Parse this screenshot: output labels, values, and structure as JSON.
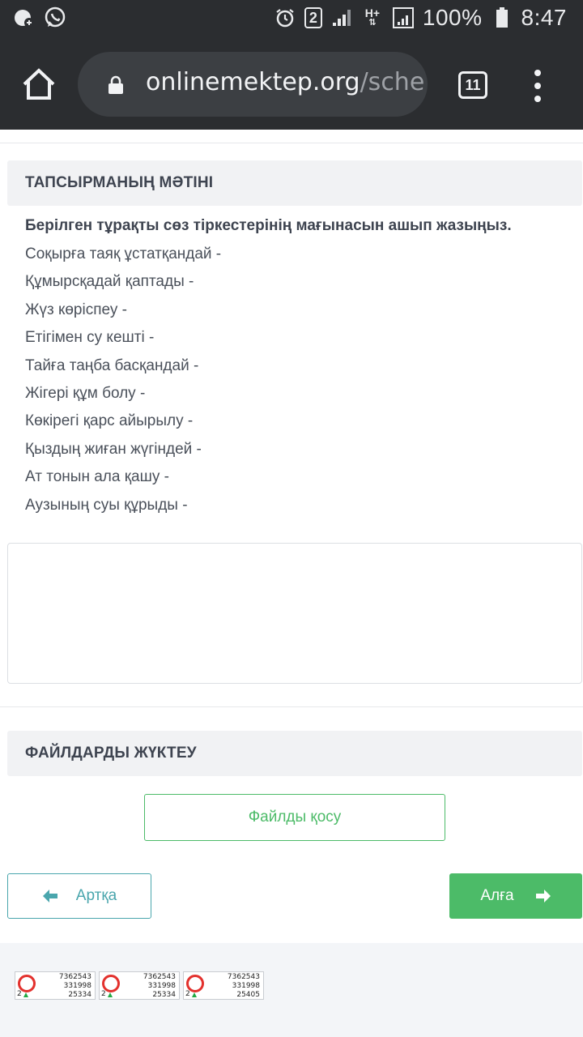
{
  "status_bar": {
    "left_icons": [
      "bug-notification-icon",
      "whatsapp-icon"
    ],
    "alarm_icon": "alarm-icon",
    "sim_badge": "2",
    "network_type": "H+",
    "battery_percent": "100%",
    "time": "8:47"
  },
  "browser": {
    "url_host": "onlinemektep.org",
    "url_path": "/sche",
    "tabs_count": "11"
  },
  "task_section": {
    "header": "ТАПСЫРМАНЫҢ МӘТІНІ",
    "title": "Берілген тұрақты сөз тіркестерінің мағынасын ашып жазыңыз.",
    "items": [
      "Соқырға таяқ ұстатқандай -",
      "Құмырсқадай қаптады -",
      "Жүз көріспеу -",
      "Етігімен су кешті -",
      "Тайға таңба басқандай -",
      "Жігері құм болу -",
      "Көкірегі қарс айырылу -",
      "Қыздың жиған жүгіндей -",
      "Ат тонын ала қашу -",
      "Аузының суы құрыды -"
    ]
  },
  "answer": {
    "value": ""
  },
  "files_section": {
    "header": "ФАЙЛДАРДЫ ЖҮКТЕУ",
    "add_file_label": "Файлды қосу"
  },
  "nav": {
    "back_label": "Артқа",
    "next_label": "Алға"
  },
  "counters": [
    {
      "small": "2",
      "line1": "7362543",
      "line2": "331998",
      "line3": "25334"
    },
    {
      "small": "2",
      "line1": "7362543",
      "line2": "331998",
      "line3": "25334"
    },
    {
      "small": "2",
      "line1": "7362543",
      "line2": "331998",
      "line3": "25405"
    }
  ],
  "colors": {
    "accent_green": "#4cbb68",
    "accent_teal": "#4aa6ad",
    "chrome_dark": "#2b2d30"
  }
}
